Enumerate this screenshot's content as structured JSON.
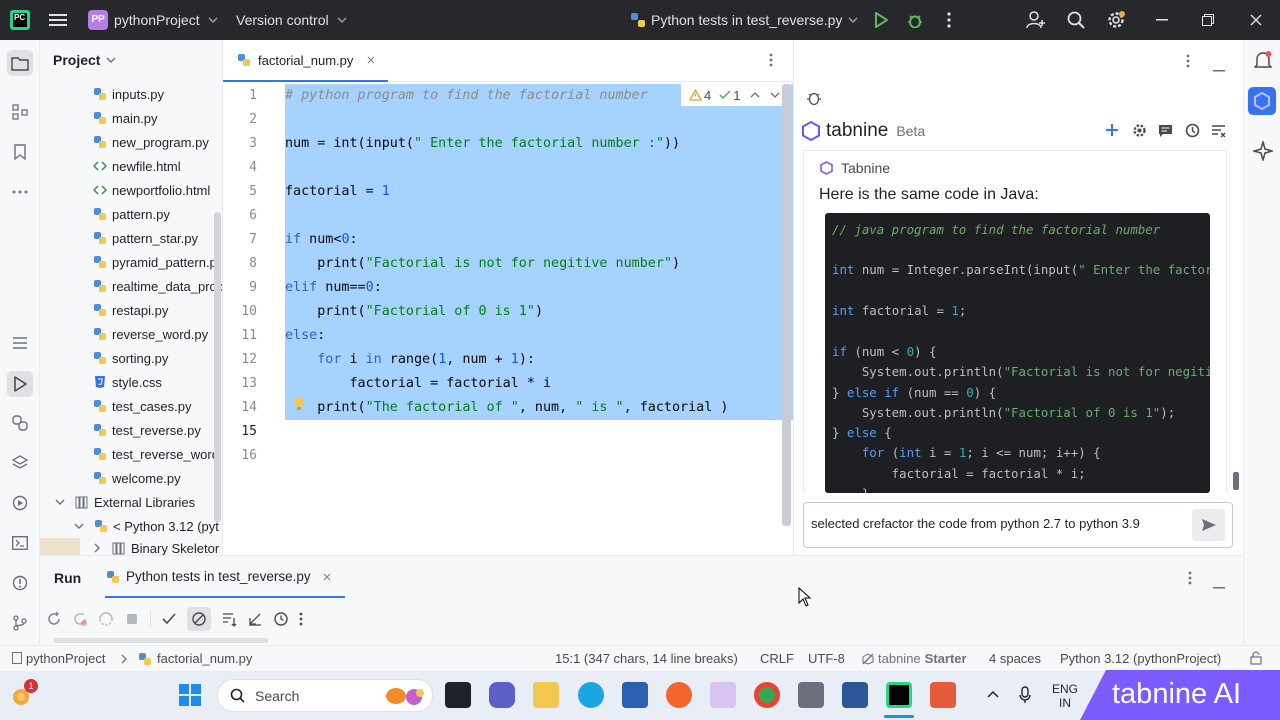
{
  "titlebar": {
    "app_badge": "PC",
    "project_badge": "PP",
    "project_name": "pythonProject",
    "version_control": "Version control",
    "run_config": "Python tests in test_reverse.py"
  },
  "project_panel": {
    "title": "Project",
    "files": [
      {
        "name": "inputs.py",
        "icon": "python-file-icon"
      },
      {
        "name": "main.py",
        "icon": "python-file-icon"
      },
      {
        "name": "new_program.py",
        "icon": "python-file-icon"
      },
      {
        "name": "newfile.html",
        "icon": "html-file-icon"
      },
      {
        "name": "newportfolio.html",
        "icon": "html-file-icon"
      },
      {
        "name": "pattern.py",
        "icon": "python-file-icon"
      },
      {
        "name": "pattern_star.py",
        "icon": "python-file-icon"
      },
      {
        "name": "pyramid_pattern.p",
        "icon": "python-file-icon"
      },
      {
        "name": "realtime_data_proc",
        "icon": "python-file-icon"
      },
      {
        "name": "restapi.py",
        "icon": "python-file-icon"
      },
      {
        "name": "reverse_word.py",
        "icon": "python-file-icon"
      },
      {
        "name": "sorting.py",
        "icon": "python-file-icon"
      },
      {
        "name": "style.css",
        "icon": "css-file-icon"
      },
      {
        "name": "test_cases.py",
        "icon": "python-file-icon"
      },
      {
        "name": "test_reverse.py",
        "icon": "python-file-icon"
      },
      {
        "name": "test_reverse_word",
        "icon": "python-file-icon"
      },
      {
        "name": "welcome.py",
        "icon": "python-file-icon"
      }
    ],
    "external_libraries": "External Libraries",
    "python_sdk": "< Python 3.12 (pyt",
    "binary_skeletons": "Binary Skeletor"
  },
  "editor": {
    "tab_name": "factorial_num.py",
    "warnings": "4",
    "checks": "1",
    "line_numbers": [
      "1",
      "2",
      "3",
      "4",
      "5",
      "6",
      "7",
      "8",
      "9",
      "10",
      "11",
      "12",
      "13",
      "14",
      "15",
      "16"
    ],
    "current_line": "15"
  },
  "tabnine": {
    "brand": "tabnine",
    "beta": "Beta",
    "author": "Tabnine",
    "intro": "Here is the same code in Java:",
    "input_value": "selected crefactor the code from python 2.7 to python 3.9"
  },
  "run_panel": {
    "title": "Run",
    "tab": "Python tests in test_reverse.py"
  },
  "statusbar": {
    "breadcrumb_project": "pythonProject",
    "breadcrumb_file": "factorial_num.py",
    "position": "15:1 (347 chars, 14 line breaks)",
    "line_sep": "CRLF",
    "encoding": "UTF-8",
    "plugin": "tabnine",
    "plugin_tier": "Starter",
    "indent": "4 spaces",
    "interpreter": "Python 3.12 (pythonProject)"
  },
  "taskbar": {
    "search": "Search",
    "lang_top": "ENG",
    "lang_bottom": "IN",
    "notif_count": "1"
  },
  "watermark": "tabnine AI",
  "colors": {
    "selection": "#a6d2ff",
    "titlebar": "#27282c",
    "accent": "#3574f0",
    "run_green": "#5fb85f",
    "tabnine_purple": "#7c5cff"
  }
}
